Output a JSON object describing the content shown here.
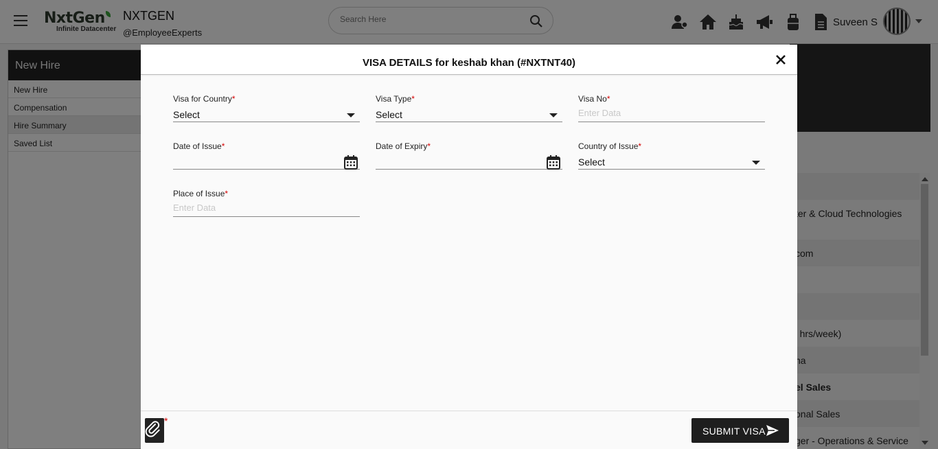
{
  "header": {
    "logo_text_a": "NxtGen",
    "logo_subtitle": "Infinite Datacenter",
    "org_name": "NXTGEN",
    "org_handle": "@EmployeeExperts",
    "search_placeholder": "Search Here",
    "user_name": "Suveen S"
  },
  "leftnav": {
    "title": "New Hire",
    "items": [
      {
        "label": "New Hire"
      },
      {
        "label": "Compensation"
      },
      {
        "label": "Hire Summary"
      },
      {
        "label": "Saved List"
      }
    ]
  },
  "background_rows": [
    {
      "text": "ter & Cloud Technologies"
    },
    {
      "text": "com"
    },
    {
      "text": "' hrs/week)"
    },
    {
      "text": "na"
    },
    {
      "text": "el Sales"
    },
    {
      "text": "onal Sales"
    },
    {
      "text": "ger - Operations & Service"
    }
  ],
  "modal": {
    "title": "VISA DETAILS for keshab khan (#NXTNT40)",
    "fields": {
      "visa_country": {
        "label": "Visa for Country",
        "value": "Select"
      },
      "visa_type": {
        "label": "Visa Type",
        "value": "Select"
      },
      "visa_no": {
        "label": "Visa No",
        "placeholder": "Enter Data"
      },
      "date_issue": {
        "label": "Date of Issue",
        "value": ""
      },
      "date_expiry": {
        "label": "Date of Expiry",
        "value": ""
      },
      "country_issue": {
        "label": "Country of Issue",
        "value": "Select"
      },
      "place_issue": {
        "label": "Place of Issue",
        "placeholder": "Enter Data"
      }
    },
    "required_mark": "*",
    "submit_label": "SUBMIT VISA"
  }
}
